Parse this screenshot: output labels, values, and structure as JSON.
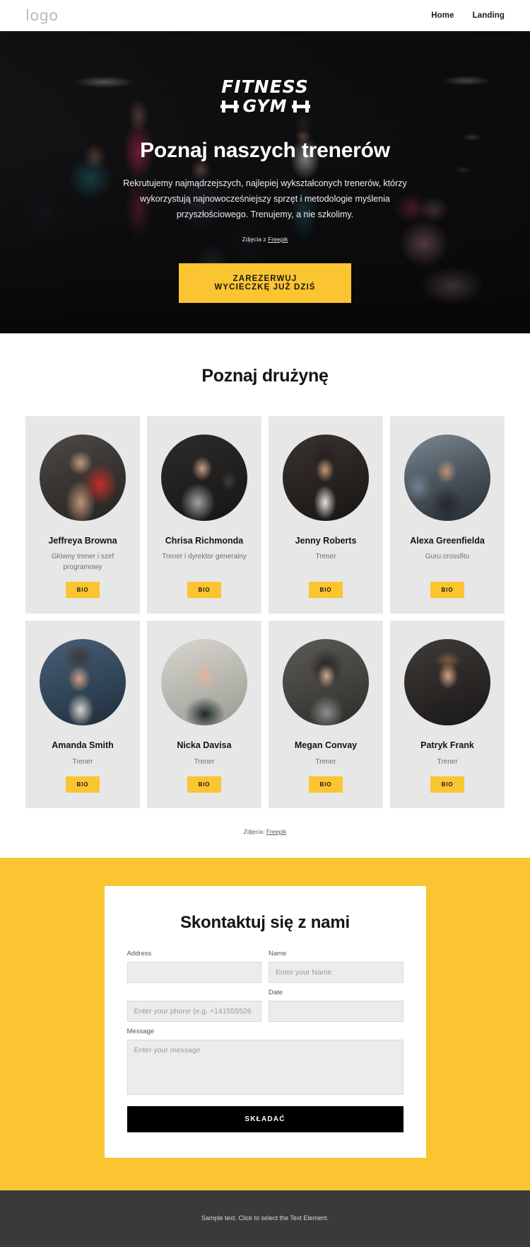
{
  "header": {
    "logo": "logo",
    "nav": [
      {
        "label": "Home"
      },
      {
        "label": "Landing"
      }
    ]
  },
  "hero": {
    "brand_line1": "FITNESS",
    "brand_line2": "GYM",
    "title": "Poznaj naszych trenerów",
    "subtitle": "Rekrutujemy najmądrzejszych, najlepiej wykształconych trenerów, którzy wykorzystują najnowocześniejszy sprzęt i metodologie myślenia przyszłościowego. Trenujemy, a nie szkolimy.",
    "credit_prefix": "Zdjęcia z ",
    "credit_link": "Freepik",
    "cta_label": "ZAREZERWUJ WYCIECZKĘ JUŻ DZIŚ"
  },
  "team": {
    "title": "Poznaj drużynę",
    "bio_label": "BIO",
    "credit_prefix": "Zdjęcia: ",
    "credit_link": "Freepik",
    "members": [
      {
        "name": "Jeffreya Browna",
        "role": "Główny trener i szef programowy"
      },
      {
        "name": "Chrisa Richmonda",
        "role": "Trener i dyrektor generalny"
      },
      {
        "name": "Jenny Roberts",
        "role": "Trener"
      },
      {
        "name": "Alexa Greenfielda",
        "role": "Guru crossfitu"
      },
      {
        "name": "Amanda Smith",
        "role": "Trener"
      },
      {
        "name": "Nicka Davisa",
        "role": "Trener"
      },
      {
        "name": "Megan Convay",
        "role": "Trener"
      },
      {
        "name": "Patryk Frank",
        "role": "Trener"
      }
    ]
  },
  "contact": {
    "title": "Skontaktuj się z nami",
    "fields": {
      "address_label": "Address",
      "address_placeholder": "",
      "name_label": "Name",
      "name_placeholder": "Enter your Name",
      "phone_label": "",
      "phone_placeholder": "Enter your phone (e.g. +141555526",
      "date_label": "Date",
      "date_placeholder": "",
      "message_label": "Message",
      "message_placeholder": "Enter your message"
    },
    "submit_label": "SKŁADAĆ"
  },
  "footer": {
    "text": "Sample text. Click to select the Text Element."
  },
  "colors": {
    "accent": "#fbc531",
    "dark": "#141414",
    "card_bg": "#e7e7e7",
    "footer_bg": "#3a3a3a"
  }
}
